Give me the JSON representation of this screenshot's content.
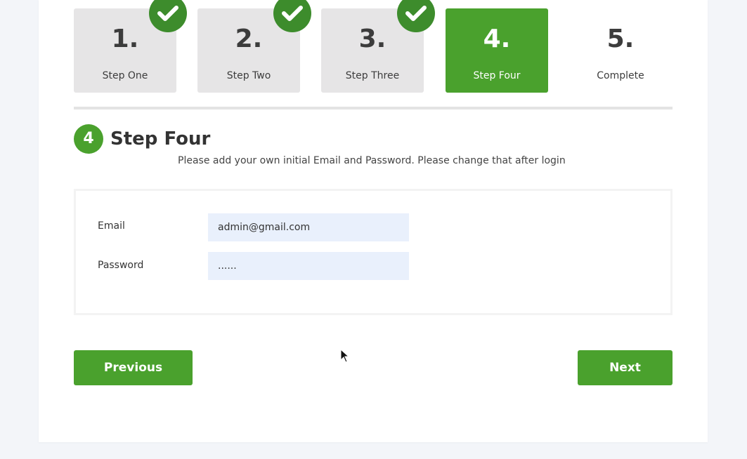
{
  "steps": [
    {
      "number": "1.",
      "label": "Step One",
      "completed": true
    },
    {
      "number": "2.",
      "label": "Step Two",
      "completed": true
    },
    {
      "number": "3.",
      "label": "Step Three",
      "completed": true
    },
    {
      "number": "4.",
      "label": "Step Four",
      "active": true
    },
    {
      "number": "5.",
      "label": "Complete"
    }
  ],
  "section": {
    "badge": "4",
    "title": "Step Four",
    "description": "Please add your own initial Email and Password. Please change that after login"
  },
  "form": {
    "email_label": "Email",
    "email_value": "admin@gmail.com",
    "password_label": "Password",
    "password_value": "......"
  },
  "buttons": {
    "previous": "Previous",
    "next": "Next"
  },
  "colors": {
    "accent": "#4aa12d",
    "check_badge": "#3d8c2c",
    "inactive_step": "#e6e5e6",
    "input_bg": "#e9f0fc"
  },
  "icons": {
    "check": "check-icon",
    "cursor": "mouse-cursor-icon"
  }
}
